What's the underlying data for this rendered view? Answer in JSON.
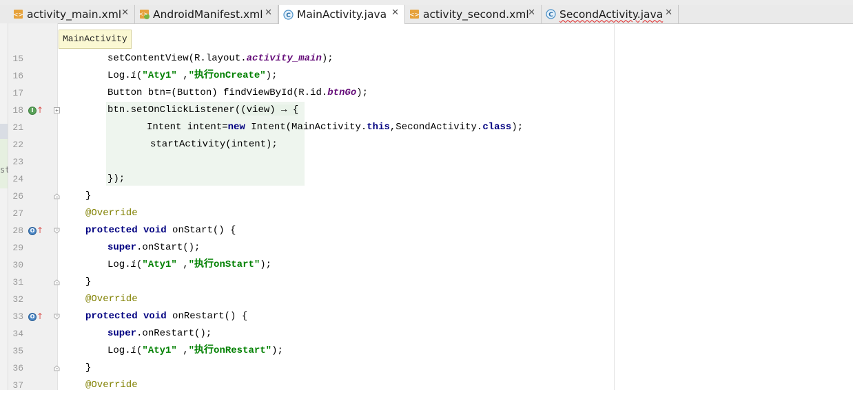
{
  "tabs": [
    {
      "label": "activity_main.xml",
      "icon": "xml-file-icon",
      "active": false,
      "error": false
    },
    {
      "label": "AndroidManifest.xml",
      "icon": "manifest-file-icon",
      "active": false,
      "error": false
    },
    {
      "label": "MainActivity.java",
      "icon": "java-class-icon",
      "active": true,
      "error": false
    },
    {
      "label": "activity_second.xml",
      "icon": "xml-file-icon",
      "active": false,
      "error": false
    },
    {
      "label": "SecondActivity.java",
      "icon": "java-class-icon",
      "active": false,
      "error": true
    }
  ],
  "close_glyph": "✕",
  "breadcrumb": "MainActivity",
  "left_strip_text": "st",
  "gutter_icons": {
    "implements": "I",
    "overrides": "O",
    "arrow": "↑"
  },
  "lines": {
    "15": {
      "num": "15",
      "p1": "setContentView(R.layout.",
      "f1": "activity_main",
      "p2": ");"
    },
    "16": {
      "num": "16",
      "p1": "Log.",
      "i1": "i",
      "p2": "(",
      "s1": "\"Aty1\"",
      "p3": " ,",
      "s2": "\"执行onCreate\"",
      "p4": ");"
    },
    "17": {
      "num": "17",
      "p1": "Button btn=(Button) findViewById(R.id.",
      "f1": "btnGo",
      "p2": ");"
    },
    "18": {
      "num": "18",
      "p1": "btn.setOnClickListener(",
      "lam": "(view) → {"
    },
    "21": {
      "num": "21",
      "p1": "Intent intent=",
      "k1": "new",
      "p2": " Intent(MainActivity.",
      "k2": "this",
      "p3": ",SecondActivity.",
      "k3": "class",
      "p4": ");"
    },
    "22": {
      "num": "22",
      "p1": "startActivity(intent);"
    },
    "23": {
      "num": "23"
    },
    "24": {
      "num": "24",
      "p1": "});"
    },
    "26": {
      "num": "26",
      "p1": "}"
    },
    "27": {
      "num": "27",
      "a1": "@Override"
    },
    "28": {
      "num": "28",
      "k1": "protected",
      "k2": "void",
      "p1": " onStart() {"
    },
    "29": {
      "num": "29",
      "k1": "super",
      "p1": ".onStart();"
    },
    "30": {
      "num": "30",
      "p1": "Log.",
      "i1": "i",
      "p2": "(",
      "s1": "\"Aty1\"",
      "p3": " ,",
      "s2": "\"执行onStart\"",
      "p4": ");"
    },
    "31": {
      "num": "31",
      "p1": "}"
    },
    "32": {
      "num": "32",
      "a1": "@Override"
    },
    "33": {
      "num": "33",
      "k1": "protected",
      "k2": "void",
      "p1": " onRestart() {"
    },
    "34": {
      "num": "34",
      "k1": "super",
      "p1": ".onRestart();"
    },
    "35": {
      "num": "35",
      "p1": "Log.",
      "i1": "i",
      "p2": "(",
      "s1": "\"Aty1\"",
      "p3": " ,",
      "s2": "\"执行onRestart\"",
      "p4": ");"
    },
    "36": {
      "num": "36",
      "p1": "}"
    },
    "37": {
      "num": "37",
      "a1": "@Override"
    }
  },
  "colors": {
    "keyword": "#000080",
    "string": "#008000",
    "field": "#660e7a",
    "annotation": "#808000",
    "line_number": "#999999"
  }
}
